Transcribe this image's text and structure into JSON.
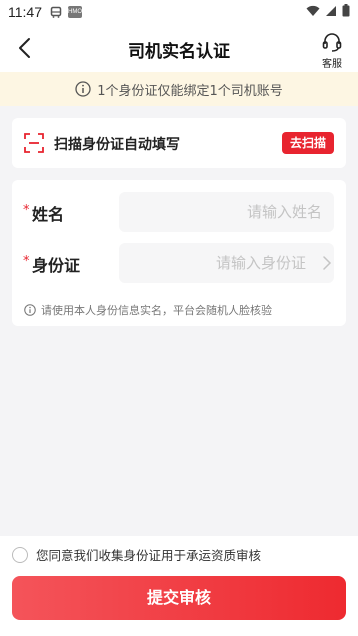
{
  "status_bar": {
    "time": "11:47"
  },
  "nav": {
    "title": "司机实名认证",
    "service_label": "客服"
  },
  "notice": {
    "text": "1个身份证仅能绑定1个司机账号"
  },
  "scan": {
    "label": "扫描身份证自动填写",
    "button_label": "去扫描"
  },
  "form": {
    "required_mark": "*",
    "name_label": "姓名",
    "name_placeholder": "请输入姓名",
    "id_label": "身份证",
    "id_placeholder": "请输入身份证",
    "tip": "请使用本人身份信息实名，平台会随机人脸核验"
  },
  "agreement": {
    "text": "您同意我们收集身份证用于承运资质审核"
  },
  "submit": {
    "label": "提交审核"
  },
  "colors": {
    "accent": "#e8242f",
    "notice_bg": "#fdf6e3",
    "page_bg": "#f4f4f6"
  }
}
